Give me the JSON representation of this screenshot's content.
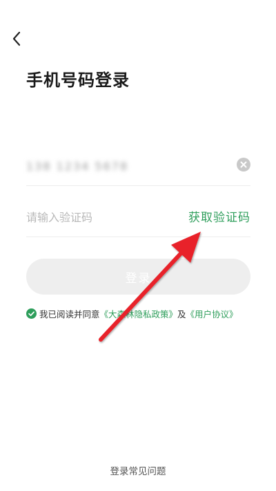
{
  "header": {
    "back_icon": "chevron-left-icon",
    "title": "手机号码登录"
  },
  "phone": {
    "value": "138 1234 5678",
    "clear_icon": "clear-circle-icon"
  },
  "code": {
    "placeholder": "请输入验证码",
    "get_code_label": "获取验证码"
  },
  "login": {
    "label": "登录"
  },
  "agreement": {
    "checked": true,
    "check_icon": "check-circle-icon",
    "prefix": "我已阅读并同意",
    "privacy_link": "《大森林隐私政策》",
    "joiner": "及",
    "user_link": "《用户协议》"
  },
  "footer": {
    "help_label": "登录常见问题"
  },
  "colors": {
    "accent": "#2e9e5b",
    "annotation": "#e8232a",
    "button_disabled": "#eeeeee"
  }
}
